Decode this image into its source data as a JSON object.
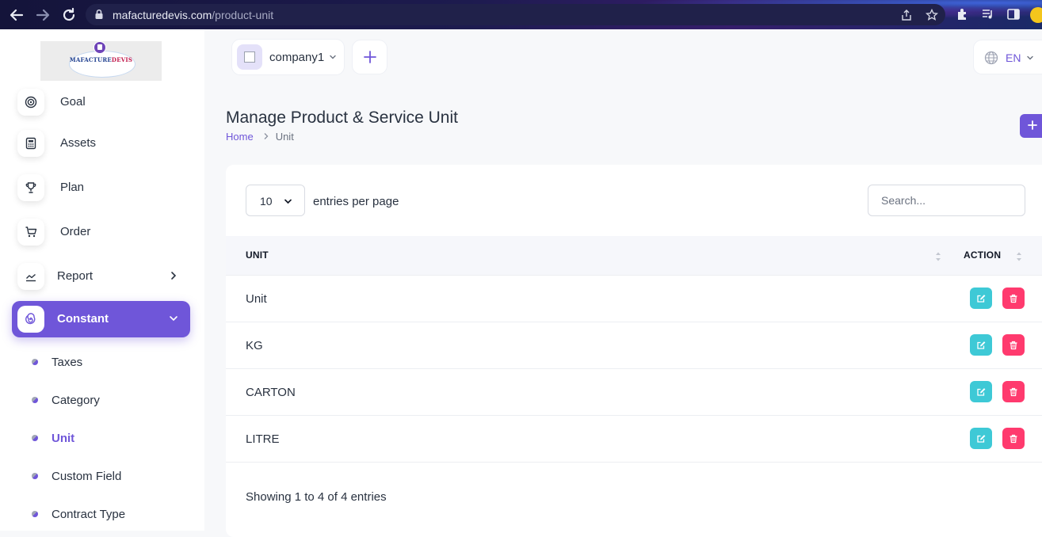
{
  "browser": {
    "url_host": "mafacturedevis.com",
    "url_path": "/product-unit"
  },
  "brand": {
    "logo_text_part1": "MAFACTURE",
    "logo_text_part2": "DEVIS",
    "accent_color": "#6f56d9"
  },
  "sidebar": {
    "items": [
      {
        "label": "Goal",
        "icon": "target-icon"
      },
      {
        "label": "Assets",
        "icon": "calculator-icon"
      },
      {
        "label": "Plan",
        "icon": "trophy-icon"
      },
      {
        "label": "Order",
        "icon": "cart-icon"
      },
      {
        "label": "Report",
        "icon": "chart-line-icon"
      },
      {
        "label": "Constant",
        "icon": "spiral-icon",
        "active": true
      }
    ],
    "sub_items": [
      {
        "label": "Taxes"
      },
      {
        "label": "Category"
      },
      {
        "label": "Unit",
        "current": true
      },
      {
        "label": "Custom Field"
      },
      {
        "label": "Contract Type"
      }
    ]
  },
  "header": {
    "company_name": "company1",
    "add_icon": "plus-icon",
    "language": "EN"
  },
  "page": {
    "title": "Manage Product & Service Unit",
    "breadcrumb_home": "Home",
    "breadcrumb_current": "Unit",
    "create_icon": "plus-icon"
  },
  "table": {
    "page_size": "10",
    "entries_label": "entries per page",
    "search_placeholder": "Search...",
    "columns": [
      "UNIT",
      "ACTION"
    ],
    "rows": [
      "Unit",
      "KG",
      "CARTON",
      "LITRE"
    ],
    "info": "Showing 1 to 4 of 4 entries",
    "edit_color": "#3ec9d6",
    "delete_color": "#ff3a6e"
  }
}
